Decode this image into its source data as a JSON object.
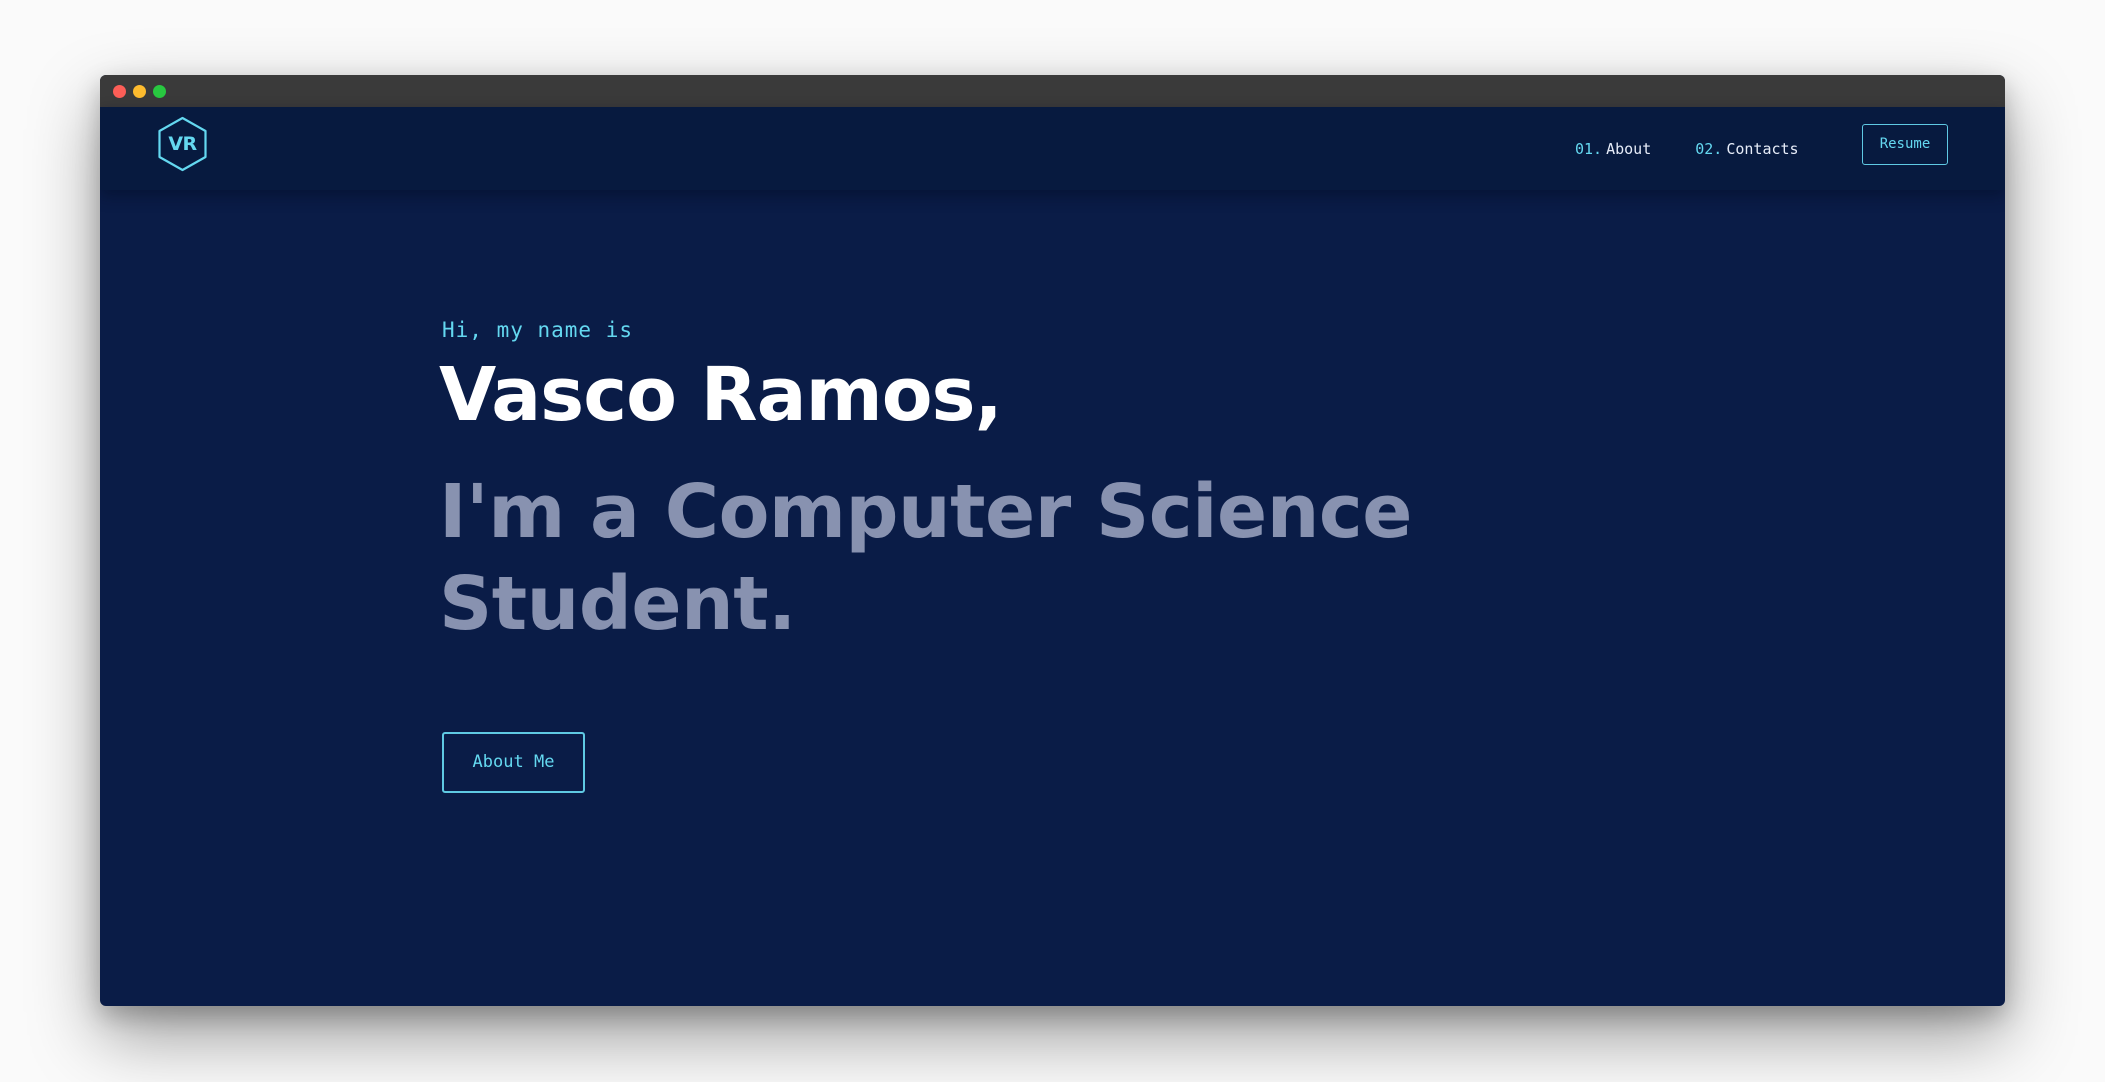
{
  "window": {
    "controls": [
      "close",
      "minimize",
      "maximize"
    ]
  },
  "navbar": {
    "logo_text": "VR",
    "links": [
      {
        "number": "01.",
        "label": "About"
      },
      {
        "number": "02.",
        "label": "Contacts"
      }
    ],
    "resume_label": "Resume"
  },
  "hero": {
    "greeting": "Hi, my name is",
    "name": "Vasco Ramos,",
    "subtitle_line1": "I'm a Computer Science",
    "subtitle_line2": "Student.",
    "button_label": "About Me"
  },
  "colors": {
    "background": "#0a1c47",
    "navbar": "#071a3f",
    "accent": "#64d8f0",
    "heading": "#ffffff",
    "subtitle": "#8892b0"
  },
  "icons": {
    "logo": "hexagon-logo-icon"
  }
}
